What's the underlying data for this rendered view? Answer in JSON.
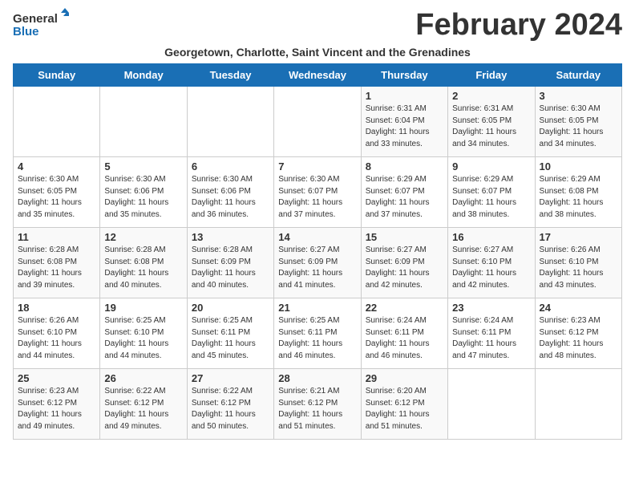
{
  "logo": {
    "line1": "General",
    "line2": "Blue"
  },
  "title": "February 2024",
  "subtitle": "Georgetown, Charlotte, Saint Vincent and the Grenadines",
  "days_of_week": [
    "Sunday",
    "Monday",
    "Tuesday",
    "Wednesday",
    "Thursday",
    "Friday",
    "Saturday"
  ],
  "weeks": [
    [
      {
        "day": "",
        "info": ""
      },
      {
        "day": "",
        "info": ""
      },
      {
        "day": "",
        "info": ""
      },
      {
        "day": "",
        "info": ""
      },
      {
        "day": "1",
        "info": "Sunrise: 6:31 AM\nSunset: 6:04 PM\nDaylight: 11 hours\nand 33 minutes."
      },
      {
        "day": "2",
        "info": "Sunrise: 6:31 AM\nSunset: 6:05 PM\nDaylight: 11 hours\nand 34 minutes."
      },
      {
        "day": "3",
        "info": "Sunrise: 6:30 AM\nSunset: 6:05 PM\nDaylight: 11 hours\nand 34 minutes."
      }
    ],
    [
      {
        "day": "4",
        "info": "Sunrise: 6:30 AM\nSunset: 6:05 PM\nDaylight: 11 hours\nand 35 minutes."
      },
      {
        "day": "5",
        "info": "Sunrise: 6:30 AM\nSunset: 6:06 PM\nDaylight: 11 hours\nand 35 minutes."
      },
      {
        "day": "6",
        "info": "Sunrise: 6:30 AM\nSunset: 6:06 PM\nDaylight: 11 hours\nand 36 minutes."
      },
      {
        "day": "7",
        "info": "Sunrise: 6:30 AM\nSunset: 6:07 PM\nDaylight: 11 hours\nand 37 minutes."
      },
      {
        "day": "8",
        "info": "Sunrise: 6:29 AM\nSunset: 6:07 PM\nDaylight: 11 hours\nand 37 minutes."
      },
      {
        "day": "9",
        "info": "Sunrise: 6:29 AM\nSunset: 6:07 PM\nDaylight: 11 hours\nand 38 minutes."
      },
      {
        "day": "10",
        "info": "Sunrise: 6:29 AM\nSunset: 6:08 PM\nDaylight: 11 hours\nand 38 minutes."
      }
    ],
    [
      {
        "day": "11",
        "info": "Sunrise: 6:28 AM\nSunset: 6:08 PM\nDaylight: 11 hours\nand 39 minutes."
      },
      {
        "day": "12",
        "info": "Sunrise: 6:28 AM\nSunset: 6:08 PM\nDaylight: 11 hours\nand 40 minutes."
      },
      {
        "day": "13",
        "info": "Sunrise: 6:28 AM\nSunset: 6:09 PM\nDaylight: 11 hours\nand 40 minutes."
      },
      {
        "day": "14",
        "info": "Sunrise: 6:27 AM\nSunset: 6:09 PM\nDaylight: 11 hours\nand 41 minutes."
      },
      {
        "day": "15",
        "info": "Sunrise: 6:27 AM\nSunset: 6:09 PM\nDaylight: 11 hours\nand 42 minutes."
      },
      {
        "day": "16",
        "info": "Sunrise: 6:27 AM\nSunset: 6:10 PM\nDaylight: 11 hours\nand 42 minutes."
      },
      {
        "day": "17",
        "info": "Sunrise: 6:26 AM\nSunset: 6:10 PM\nDaylight: 11 hours\nand 43 minutes."
      }
    ],
    [
      {
        "day": "18",
        "info": "Sunrise: 6:26 AM\nSunset: 6:10 PM\nDaylight: 11 hours\nand 44 minutes."
      },
      {
        "day": "19",
        "info": "Sunrise: 6:25 AM\nSunset: 6:10 PM\nDaylight: 11 hours\nand 44 minutes."
      },
      {
        "day": "20",
        "info": "Sunrise: 6:25 AM\nSunset: 6:11 PM\nDaylight: 11 hours\nand 45 minutes."
      },
      {
        "day": "21",
        "info": "Sunrise: 6:25 AM\nSunset: 6:11 PM\nDaylight: 11 hours\nand 46 minutes."
      },
      {
        "day": "22",
        "info": "Sunrise: 6:24 AM\nSunset: 6:11 PM\nDaylight: 11 hours\nand 46 minutes."
      },
      {
        "day": "23",
        "info": "Sunrise: 6:24 AM\nSunset: 6:11 PM\nDaylight: 11 hours\nand 47 minutes."
      },
      {
        "day": "24",
        "info": "Sunrise: 6:23 AM\nSunset: 6:12 PM\nDaylight: 11 hours\nand 48 minutes."
      }
    ],
    [
      {
        "day": "25",
        "info": "Sunrise: 6:23 AM\nSunset: 6:12 PM\nDaylight: 11 hours\nand 49 minutes."
      },
      {
        "day": "26",
        "info": "Sunrise: 6:22 AM\nSunset: 6:12 PM\nDaylight: 11 hours\nand 49 minutes."
      },
      {
        "day": "27",
        "info": "Sunrise: 6:22 AM\nSunset: 6:12 PM\nDaylight: 11 hours\nand 50 minutes."
      },
      {
        "day": "28",
        "info": "Sunrise: 6:21 AM\nSunset: 6:12 PM\nDaylight: 11 hours\nand 51 minutes."
      },
      {
        "day": "29",
        "info": "Sunrise: 6:20 AM\nSunset: 6:12 PM\nDaylight: 11 hours\nand 51 minutes."
      },
      {
        "day": "",
        "info": ""
      },
      {
        "day": "",
        "info": ""
      }
    ]
  ]
}
